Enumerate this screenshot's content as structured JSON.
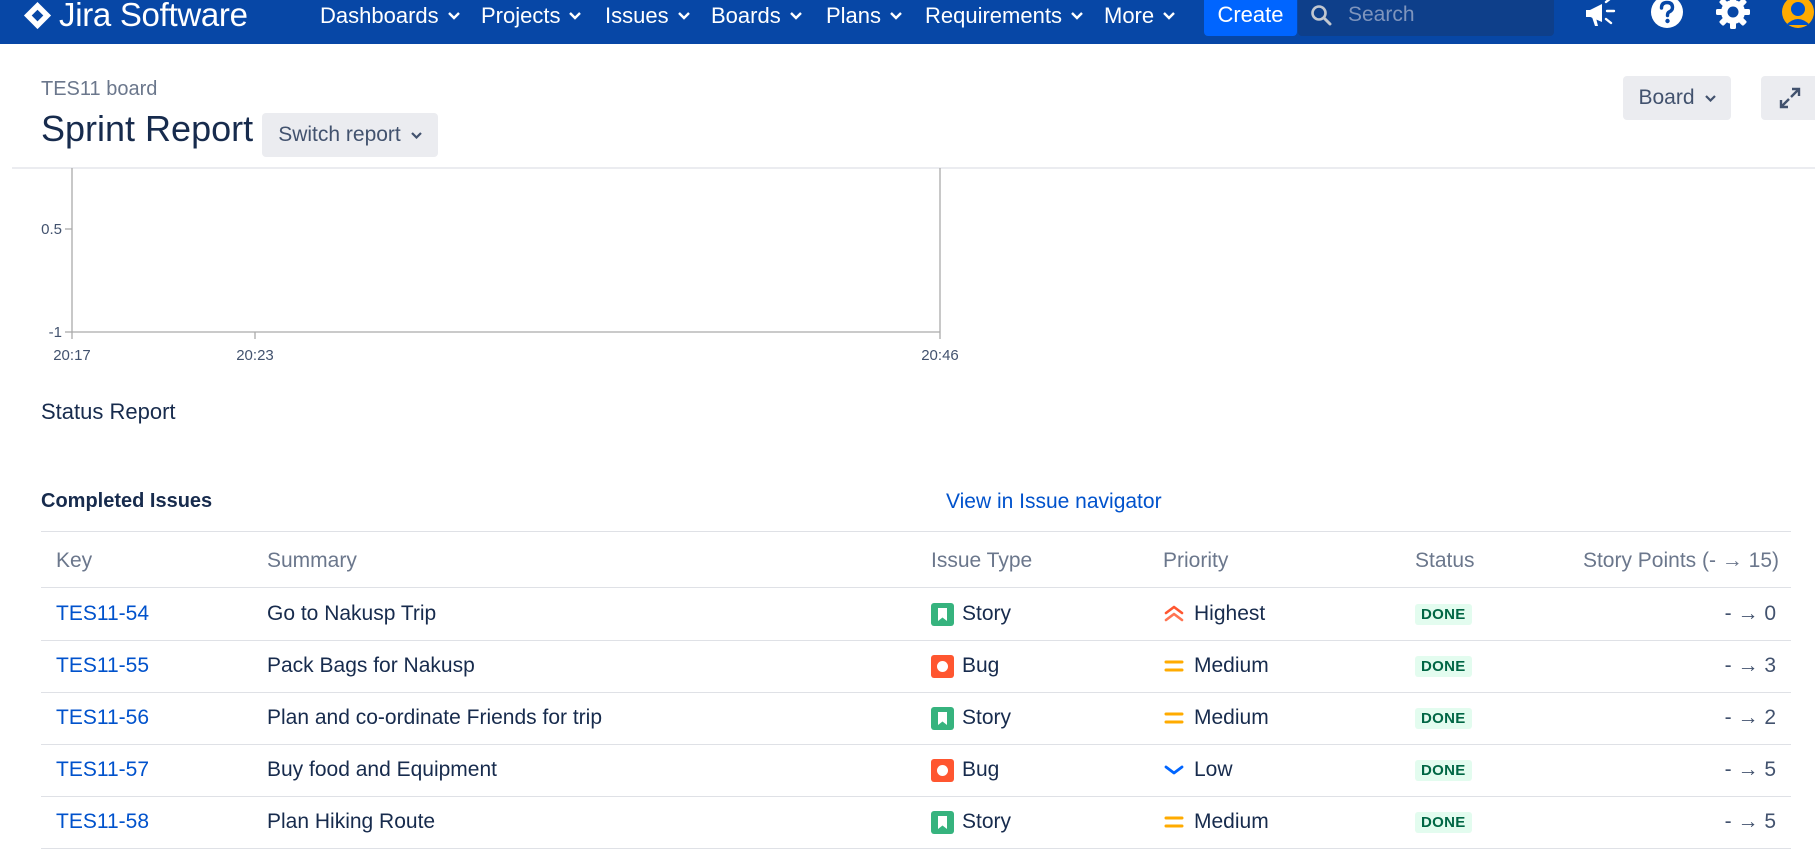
{
  "colors": {
    "nav_bg": "#0747a6",
    "create_bg": "#0065ff",
    "link": "#0052cc",
    "done_bg": "#e3fcef",
    "done_text": "#006644",
    "story": "#36b37e",
    "bug": "#ff5630",
    "priority_highest": "#ff5630",
    "priority_medium": "#ffab00",
    "priority_low": "#0065ff"
  },
  "topnav": {
    "logo_text": "Jira Software",
    "items": [
      "Dashboards",
      "Projects",
      "Issues",
      "Boards",
      "Plans",
      "Requirements",
      "More"
    ],
    "create_label": "Create",
    "search_placeholder": "Search",
    "icons": [
      "notifications-megaphone-icon",
      "help-icon",
      "settings-gear-icon",
      "user-avatar-icon"
    ]
  },
  "header": {
    "breadcrumb": "TES11 board",
    "title": "Sprint Report",
    "switch_report_label": "Switch report",
    "board_label": "Board"
  },
  "chart_data": {
    "type": "line",
    "y_ticks": [
      "0.5",
      "-1"
    ],
    "x_ticks": [
      "20:17",
      "20:23",
      "20:46"
    ],
    "series": []
  },
  "status_report": {
    "title": "Status Report"
  },
  "completed": {
    "title": "Completed Issues",
    "navigator_link": "View in Issue navigator",
    "columns": [
      "Key",
      "Summary",
      "Issue Type",
      "Priority",
      "Status",
      "Story Points (- → 15)"
    ],
    "rows": [
      {
        "key": "TES11-54",
        "summary": "Go to Nakusp Trip",
        "type": "Story",
        "type_icon": "story-icon",
        "priority": "Highest",
        "priority_icon": "priority-highest-icon",
        "status": "DONE",
        "points": "- → 0"
      },
      {
        "key": "TES11-55",
        "summary": "Pack Bags for Nakusp",
        "type": "Bug",
        "type_icon": "bug-icon",
        "priority": "Medium",
        "priority_icon": "priority-medium-icon",
        "status": "DONE",
        "points": "- → 3"
      },
      {
        "key": "TES11-56",
        "summary": "Plan and co-ordinate Friends for trip",
        "type": "Story",
        "type_icon": "story-icon",
        "priority": "Medium",
        "priority_icon": "priority-medium-icon",
        "status": "DONE",
        "points": "- → 2"
      },
      {
        "key": "TES11-57",
        "summary": "Buy food and Equipment",
        "type": "Bug",
        "type_icon": "bug-icon",
        "priority": "Low",
        "priority_icon": "priority-low-icon",
        "status": "DONE",
        "points": "- → 5"
      },
      {
        "key": "TES11-58",
        "summary": "Plan Hiking Route",
        "type": "Story",
        "type_icon": "story-icon",
        "priority": "Medium",
        "priority_icon": "priority-medium-icon",
        "status": "DONE",
        "points": "- → 5"
      }
    ]
  }
}
